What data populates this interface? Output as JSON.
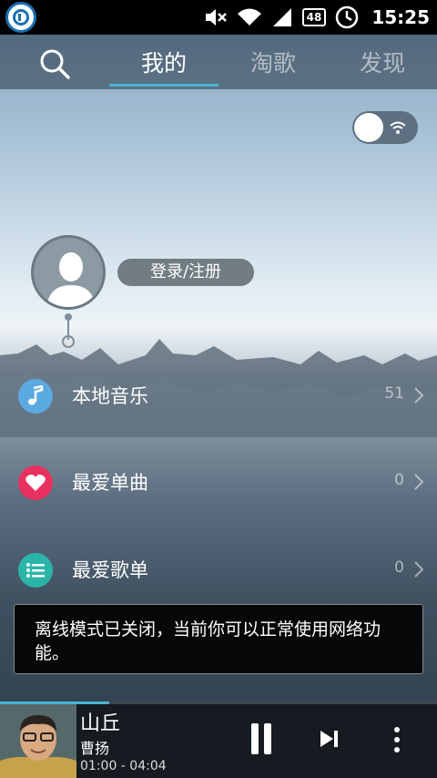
{
  "status_bar": {
    "time": "15:25",
    "battery": "48",
    "icons": [
      "app-icon",
      "mute-icon",
      "wifi-icon",
      "signal-icon",
      "battery-icon",
      "alarm-icon"
    ]
  },
  "nav": {
    "search_icon": "search-icon",
    "tabs": [
      {
        "label": "我的",
        "active": true
      },
      {
        "label": "淘歌",
        "active": false
      },
      {
        "label": "发现",
        "active": false
      }
    ],
    "accent": "#4cb3d6"
  },
  "profile": {
    "login_label": "登录/注册",
    "wifi_toggle": {
      "state": "off",
      "icon": "wifi-icon"
    }
  },
  "menu": [
    {
      "label": "本地音乐",
      "count": "51",
      "icon": "music-note-icon",
      "color": "#5aa9e0"
    },
    {
      "label": "最爱单曲",
      "count": "0",
      "icon": "heart-icon",
      "color": "#e8315e"
    },
    {
      "label": "最爱歌单",
      "count": "0",
      "icon": "list-icon",
      "color": "#2bb5a9"
    }
  ],
  "toast": {
    "text": "离线模式已关闭，当前你可以正常使用网络功能。"
  },
  "player": {
    "title": "山丘",
    "artist": "曹扬",
    "time": "01:00 - 04:04",
    "progress": 0.25,
    "controls": [
      "pause-icon",
      "next-icon",
      "more-icon"
    ]
  }
}
